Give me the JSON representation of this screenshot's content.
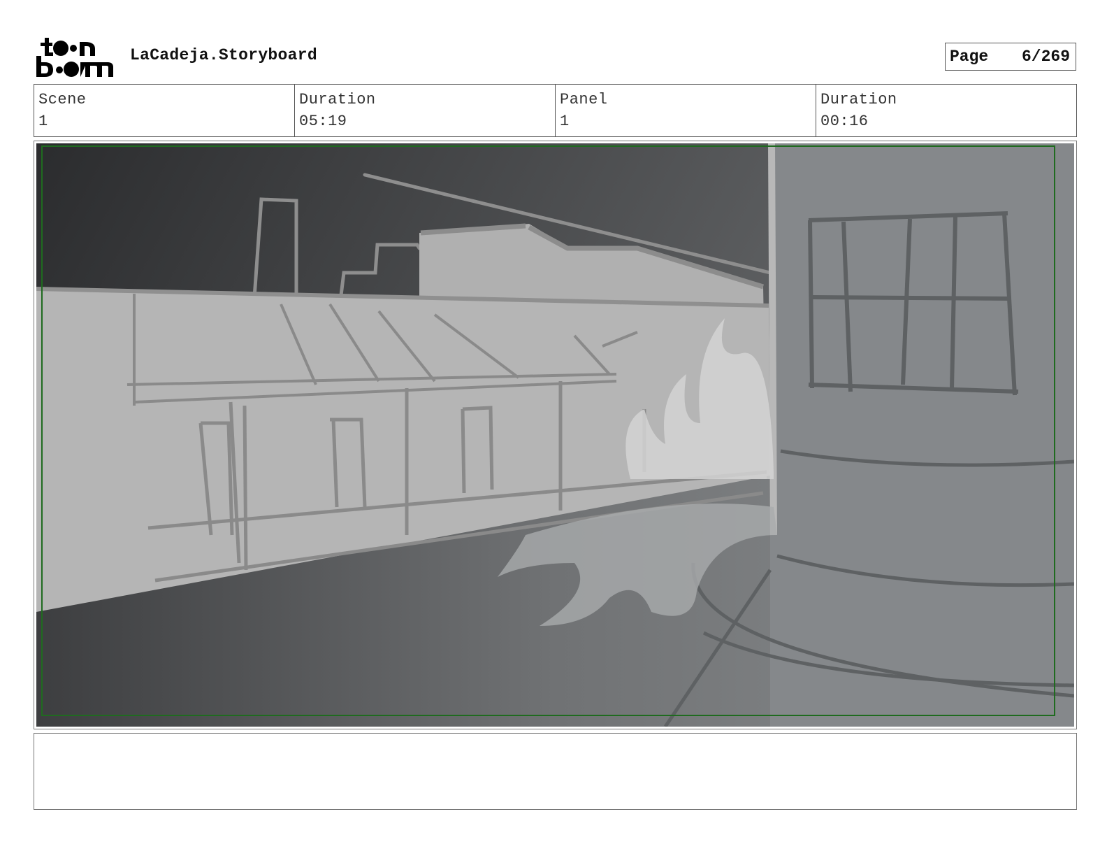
{
  "header": {
    "logo_text": "toon boom",
    "project_title": "LaCadeja.Storyboard",
    "page_label": "Page",
    "page_value": "6/269"
  },
  "info": {
    "scene_label": "Scene",
    "scene_value": "1",
    "scene_duration_label": "Duration",
    "scene_duration_value": "05:19",
    "panel_label": "Panel",
    "panel_value": "1",
    "panel_duration_label": "Duration",
    "panel_duration_value": "00:16"
  },
  "colors": {
    "frame_guide": "#1f6b1f",
    "sky_dark": "#2b2c2e",
    "sky_light": "#6f7173",
    "building": "#b4b4b4",
    "right_wall": "#85888b"
  }
}
